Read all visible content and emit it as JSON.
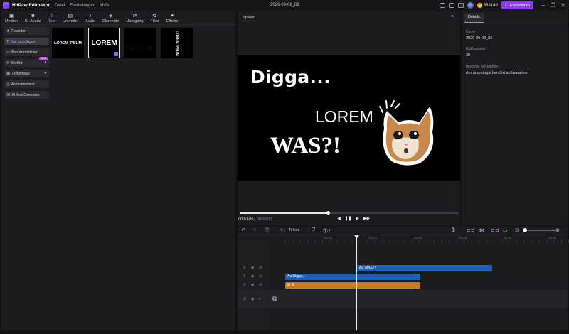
{
  "app": {
    "name": "HitPaw Edimakor",
    "menus": [
      "Datei",
      "Einstellungen",
      "Hilfe"
    ],
    "project_title": "2026-09-08_02",
    "credits": "383148",
    "export_label": "Exportieren"
  },
  "tabs": [
    {
      "label": "Medien",
      "icon": "media-icon"
    },
    {
      "label": "KI-Avatar",
      "icon": "avatar-icon"
    },
    {
      "label": "Text",
      "icon": "text-icon"
    },
    {
      "label": "Untertitel",
      "icon": "subtitle-icon"
    },
    {
      "label": "Audio",
      "icon": "audio-icon"
    },
    {
      "label": "Elemente",
      "icon": "elements-icon"
    },
    {
      "label": "Übergang",
      "icon": "transition-icon"
    },
    {
      "label": "Filter",
      "icon": "filter-icon"
    },
    {
      "label": "Effekte",
      "icon": "effects-icon"
    }
  ],
  "sidebar": {
    "items": [
      {
        "label": "Favoriten"
      },
      {
        "label": "Text hinzufügen"
      },
      {
        "label": "Benutzerdefiniert"
      },
      {
        "label": "WortArt",
        "badge": "NEW"
      },
      {
        "label": "Textvorlage"
      },
      {
        "label": "Animationstext"
      },
      {
        "label": "KI Text Generator"
      }
    ]
  },
  "templates": [
    {
      "text": "LOREM IPSUM"
    },
    {
      "text": "LOREM"
    },
    {
      "text": ""
    },
    {
      "text": "LOREM IPSUM"
    }
  ],
  "player": {
    "title": "Spieler",
    "canvas_texts": {
      "digga": "Digga...",
      "lorem": "LOREM",
      "was": "WAS?!"
    },
    "time_current": "00:01:06",
    "time_separator": "/",
    "time_total": "00:03:00",
    "progress": 0.4
  },
  "details": {
    "tab": "Details",
    "name_label": "Name",
    "name_value": "2026-09-08_02",
    "fps_label": "Bildfrequenz",
    "fps_value": "30",
    "method_label": "Methode der Einfuhr",
    "method_value": "Am ursprünglichen Ort aufbewahren"
  },
  "timeline": {
    "split_label": "Teilen",
    "ruler_labels": [
      "00:00",
      "00:01",
      "00:02",
      "00:03",
      "00:04",
      "00:05"
    ],
    "clips": {
      "was": "WAS?!",
      "digga": "Digga..."
    }
  },
  "colors": {
    "accent": "#8e3cf3",
    "clip_blue": "#1c61b8",
    "clip_orange": "#c97a1f"
  }
}
